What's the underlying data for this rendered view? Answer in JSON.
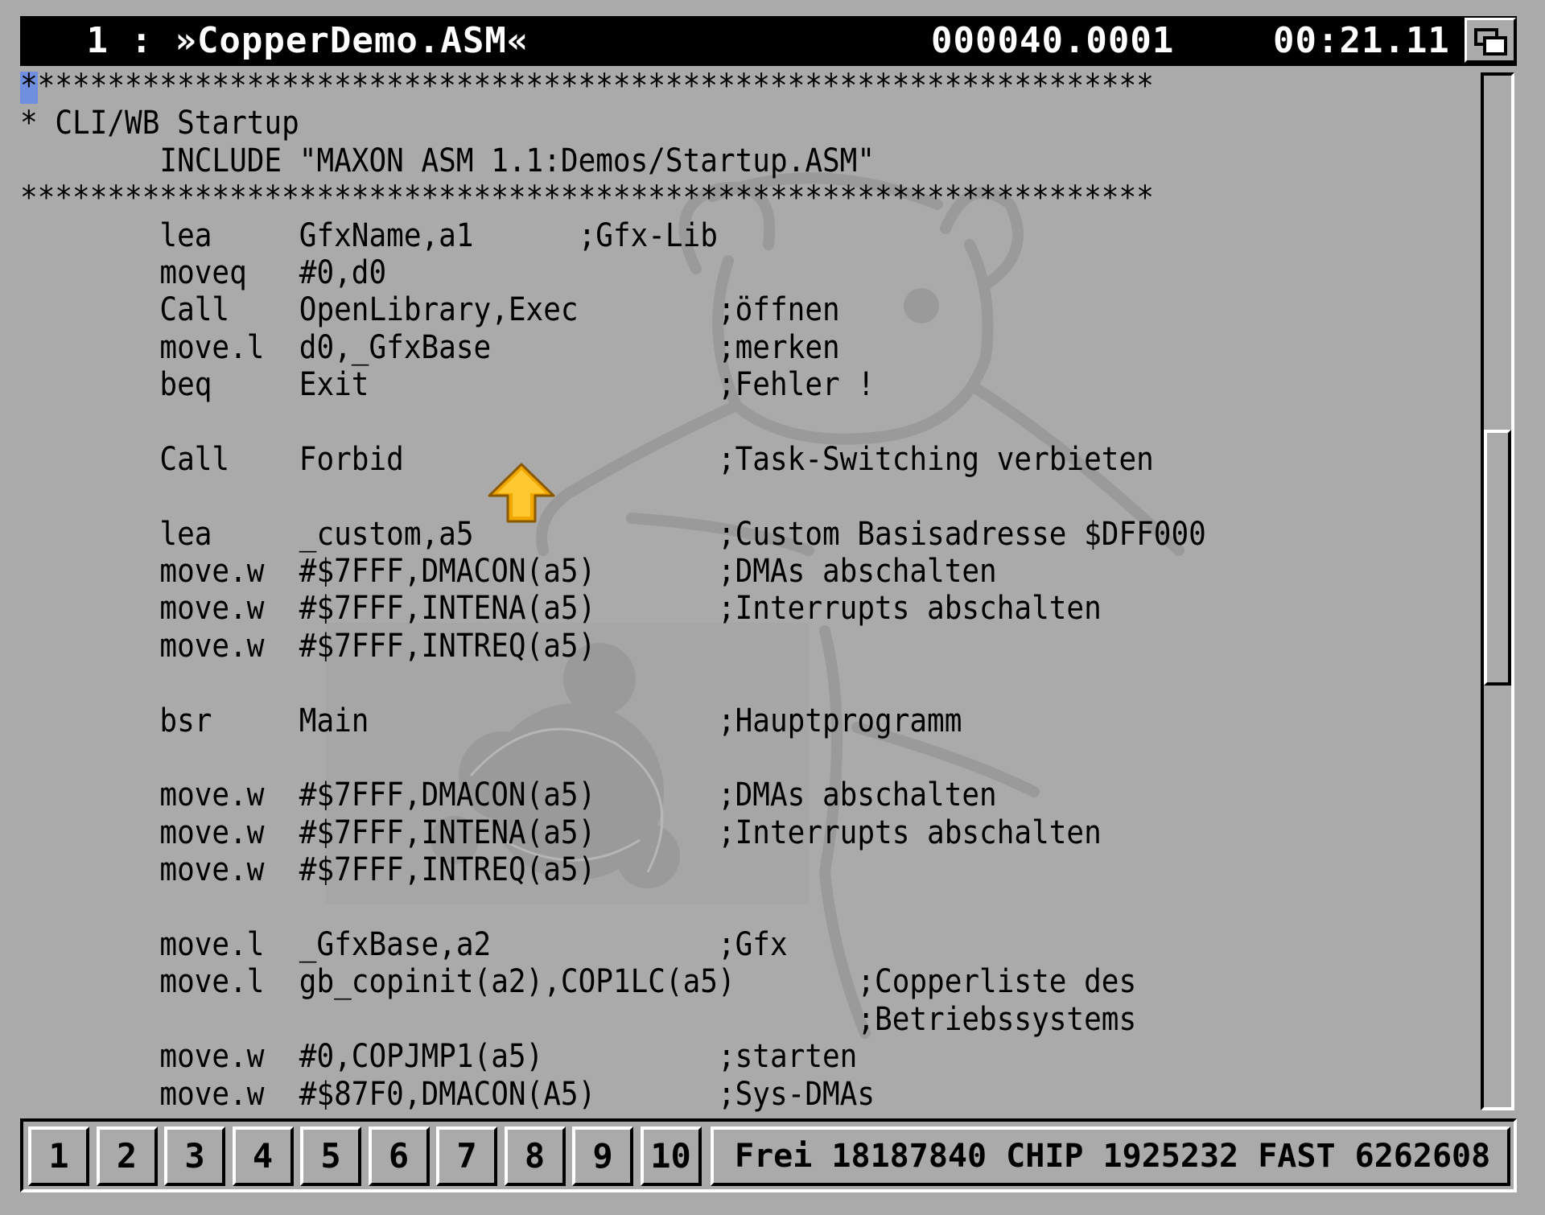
{
  "titlebar": {
    "file": " 1 : »CopperDemo.ASM«",
    "position": "000040.0001",
    "time": "00:21.11"
  },
  "editor": {
    "lines": [
      "*****************************************************************",
      "* CLI/WB Startup",
      "        INCLUDE \"MAXON ASM 1.1:Demos/Startup.ASM\"",
      "*****************************************************************",
      "        lea     GfxName,a1      ;Gfx-Lib",
      "        moveq   #0,d0",
      "        Call    OpenLibrary,Exec        ;öffnen",
      "        move.l  d0,_GfxBase             ;merken",
      "        beq     Exit                    ;Fehler !",
      "",
      "        Call    Forbid                  ;Task-Switching verbieten",
      "",
      "        lea     _custom,a5              ;Custom Basisadresse $DFF000",
      "        move.w  #$7FFF,DMACON(a5)       ;DMAs abschalten",
      "        move.w  #$7FFF,INTENA(a5)       ;Interrupts abschalten",
      "        move.w  #$7FFF,INTREQ(a5)",
      "",
      "        bsr     Main                    ;Hauptprogramm",
      "",
      "        move.w  #$7FFF,DMACON(a5)       ;DMAs abschalten",
      "        move.w  #$7FFF,INTENA(a5)       ;Interrupts abschalten",
      "        move.w  #$7FFF,INTREQ(a5)",
      "",
      "        move.l  _GfxBase,a2             ;Gfx",
      "        move.l  gb_copinit(a2),COP1LC(a5)       ;Copperliste des",
      "                                                ;Betriebssystems",
      "        move.w  #0,COPJMP1(a5)          ;starten",
      "        move.w  #$87F0,DMACON(A5)       ;Sys-DMAs"
    ]
  },
  "bottombar": {
    "slots": [
      "1",
      "2",
      "3",
      "4",
      "5",
      "6",
      "7",
      "8",
      "9",
      "10"
    ],
    "memory": "Frei 18187840 CHIP 1925232 FAST 6262608"
  },
  "colors": {
    "background": "#aaaaaa",
    "titlebar": "#000000",
    "titletext": "#ffffff",
    "cursor": "#6f8fdf",
    "arrow": "#f0a800"
  },
  "icons": {
    "depth_gadget": "depth-arrange-icon",
    "pointer": "up-arrow-pointer-icon"
  }
}
